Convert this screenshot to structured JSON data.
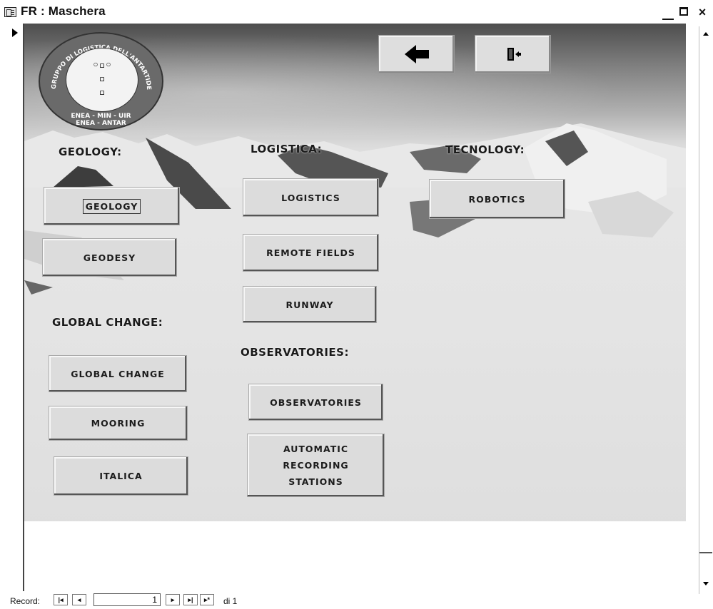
{
  "window": {
    "title": "FR : Maschera",
    "minimize_glyph": "_",
    "close_glyph": "×"
  },
  "logo": {
    "ring_text": "GRUPPO DI LOGISTICA DELL'ANTARTIDE",
    "glyphs": "◦▫◦\n▫\n▫",
    "bottom_line1": "ENEA - MIN - UIR",
    "bottom_line2": "ENEA - ANTAR"
  },
  "nav": {
    "back_icon": "arrow-left-icon",
    "exit_icon": "exit-door-icon"
  },
  "headings": {
    "geology": "GEOLOGY:",
    "logistica": "LOGISTICA:",
    "tecnology": "TECNOLOGY:",
    "global_change": "GLOBAL CHANGE:",
    "observatories": "OBSERVATORIES:"
  },
  "buttons": {
    "geology": "GEOLOGY",
    "geodesy": "GEODESY",
    "global_change": "GLOBAL CHANGE",
    "mooring": "MOORING",
    "italica": "ITALICA",
    "logistics": "LOGISTICS",
    "remote_fields": "REMOTE FIELDS",
    "runway": "RUNWAY",
    "observatories": "OBSERVATORIES",
    "automatic_recording_stations": "AUTOMATIC\nRECORDING\nSTATIONS",
    "robotics": "ROBOTICS"
  },
  "record_nav": {
    "label": "Record:",
    "first": "|◂",
    "prev": "◂",
    "current": "1",
    "next": "▸",
    "last": "▸|",
    "new": "▸*",
    "total": "di 1"
  }
}
